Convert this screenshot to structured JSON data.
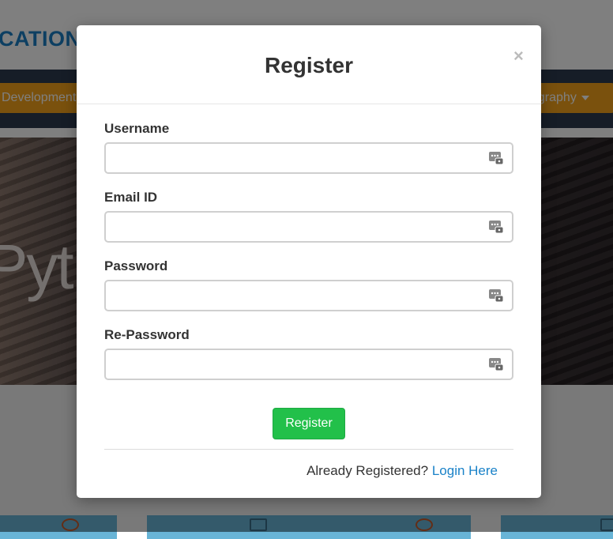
{
  "background": {
    "brand_text": "CATION",
    "nav_left_label": "Development",
    "nav_right_label": "ography",
    "hero_text": "Pyth"
  },
  "modal": {
    "title": "Register",
    "close_symbol": "×",
    "fields": [
      {
        "label": "Username",
        "value": "",
        "type": "text",
        "icon": "password-manager-key-icon"
      },
      {
        "label": "Email ID",
        "value": "",
        "type": "email",
        "icon": "password-manager-key-icon"
      },
      {
        "label": "Password",
        "value": "",
        "type": "password",
        "icon": "password-manager-key-icon"
      },
      {
        "label": "Re-Password",
        "value": "",
        "type": "password",
        "icon": "password-manager-key-icon"
      }
    ],
    "submit_label": "Register",
    "footer_text": "Already Registered?",
    "login_link_label": "Login Here"
  },
  "colors": {
    "brand": "#1a7fc4",
    "nav_button": "#f5a31a",
    "submit": "#22c04a",
    "link": "#1a82c8"
  }
}
